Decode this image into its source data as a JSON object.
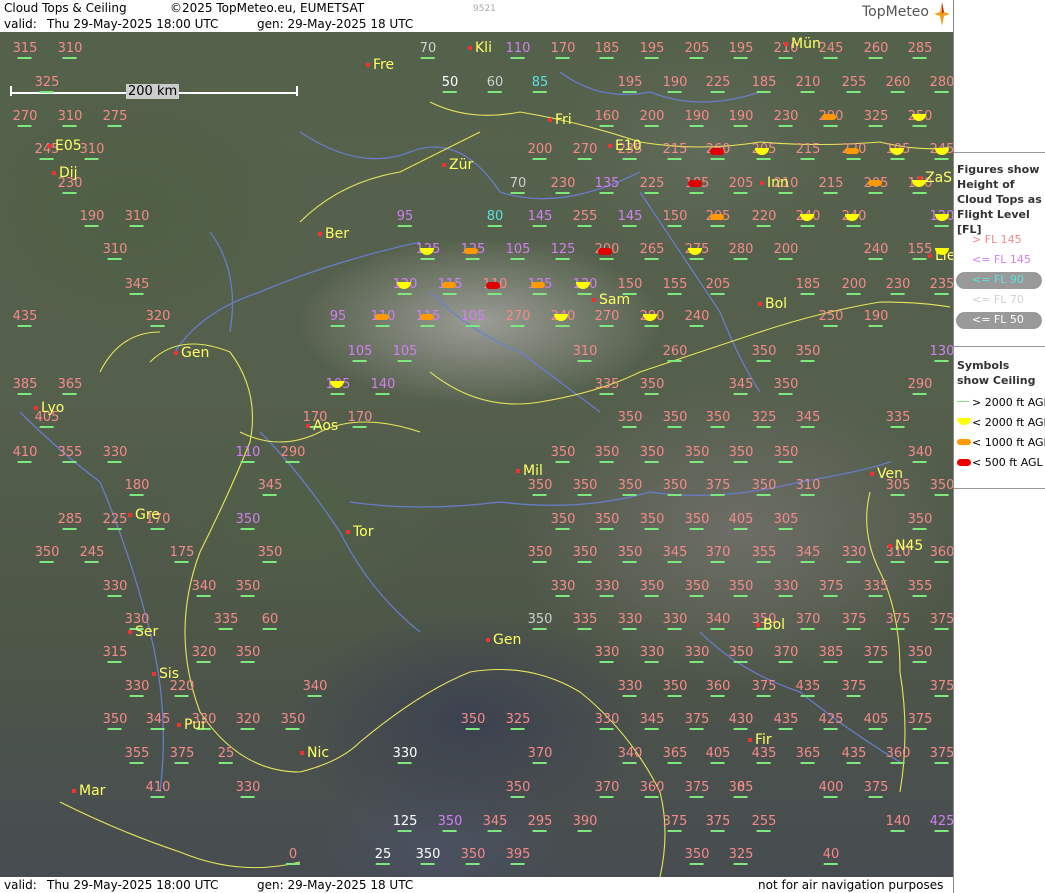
{
  "header": {
    "title": "Cloud Tops & Ceiling",
    "copyright": "©2025 TopMeteo.eu, EUMETSAT",
    "code": "9521",
    "valid_label": "valid:",
    "valid_value": "Thu  29-May-2025  18:00 UTC",
    "gen": "gen: 29-May-2025 18 UTC",
    "logo": "TopMeteo"
  },
  "scale": {
    "label": "200 km"
  },
  "legend": {
    "figures_title": "Figures show Height of Cloud Tops as Flight Level  [FL]",
    "fl_gt145": "> FL 145",
    "fl_le145": "<= FL 145",
    "fl_le90": "<= FL 90",
    "fl_le70": "<= FL 70",
    "fl_le50": "<= FL 50",
    "symbols_title": "Symbols show Ceiling",
    "ceil_2000_line": "> 2000 ft AGL",
    "ceil_2000": "< 2000 ft AGL",
    "ceil_1000": "< 1000 ft AGL",
    "ceil_500": "< 500 ft AGL",
    "colors": {
      "red": "#f58a8a",
      "magenta": "#d27ff0",
      "cyan": "#5ee0e0",
      "grey": "#d0d0d0",
      "white": "#ffffff",
      "yellow": "#ffff00",
      "orange": "#ff9900",
      "darkred": "#e00000",
      "green": "#7ee87e"
    }
  },
  "footer": {
    "valid_label": "valid:",
    "valid_value": "Thu  29-May-2025  18:00 UTC",
    "gen": "gen: 29-May-2025 18 UTC",
    "note": "not for air navigation purposes"
  },
  "cities": [
    "Fre",
    "Kli",
    "Mün",
    "Fri",
    "E05",
    "Dij",
    "Zür",
    "E10",
    "Inn",
    "ZaS",
    "Ber",
    "Lie",
    "Sam",
    "Bol",
    "Gen",
    "Lyo",
    "Aos",
    "Mil",
    "Ven",
    "Gre",
    "Tor",
    "N45",
    "Ser",
    "Gen",
    "Bol",
    "Sis",
    "Pui",
    "Nic",
    "Fir",
    "Mar"
  ],
  "values": [
    "315",
    "310",
    "70",
    "110",
    "170",
    "185",
    "195",
    "205",
    "195",
    "210",
    "245",
    "260",
    "285",
    "325",
    "50",
    "60",
    "85",
    "195",
    "190",
    "225",
    "185",
    "210",
    "255",
    "260",
    "280",
    "270",
    "310",
    "275",
    "160",
    "200",
    "190",
    "190",
    "230",
    "290",
    "325",
    "250",
    "245",
    "310",
    "200",
    "270",
    "235",
    "215",
    "260",
    "205",
    "215",
    "220",
    "195",
    "245",
    "230",
    "70",
    "230",
    "135",
    "225",
    "185",
    "205",
    "210",
    "215",
    "205",
    "170",
    "190",
    "310",
    "95",
    "80",
    "145",
    "255",
    "145",
    "150",
    "205",
    "220",
    "240",
    "240",
    "120",
    "310",
    "125",
    "125",
    "105",
    "125",
    "200",
    "265",
    "275",
    "280",
    "200",
    "240",
    "155",
    "345",
    "120",
    "115",
    "110",
    "125",
    "130",
    "150",
    "155",
    "205",
    "185",
    "200",
    "230",
    "235",
    "435",
    "320",
    "95",
    "110",
    "115",
    "105",
    "270",
    "240",
    "270",
    "290",
    "240",
    "250",
    "190",
    "105",
    "105",
    "310",
    "260",
    "350",
    "350",
    "130",
    "385",
    "365",
    "105",
    "140",
    "335",
    "350",
    "345",
    "350",
    "290",
    "405",
    "170",
    "170",
    "410",
    "355",
    "330",
    "110",
    "290",
    "350",
    "350",
    "350",
    "350",
    "350",
    "350",
    "340",
    "350",
    "350",
    "350",
    "325",
    "345",
    "335",
    "180",
    "345",
    "350",
    "350",
    "350",
    "350",
    "375",
    "350",
    "310",
    "305",
    "350",
    "285",
    "225",
    "170",
    "350",
    "350",
    "350",
    "350",
    "350",
    "405",
    "305",
    "350",
    "350",
    "245",
    "175",
    "350",
    "350",
    "350",
    "350",
    "345",
    "370",
    "355",
    "345",
    "330",
    "310",
    "360",
    "330",
    "340",
    "350",
    "330",
    "330",
    "350",
    "350",
    "350",
    "330",
    "375",
    "335",
    "355",
    "330",
    "335",
    "60",
    "350",
    "335",
    "330",
    "330",
    "340",
    "350",
    "370",
    "375",
    "375",
    "375",
    "315",
    "320",
    "350",
    "330",
    "330",
    "330",
    "350",
    "370",
    "385",
    "375",
    "350",
    "330",
    "220",
    "340",
    "330",
    "350",
    "360",
    "375",
    "435",
    "375",
    "375",
    "350",
    "345",
    "330",
    "320",
    "350",
    "350",
    "325",
    "330",
    "345",
    "375",
    "430",
    "435",
    "425",
    "405",
    "375",
    "355",
    "375",
    "25",
    "330",
    "370",
    "340",
    "365",
    "405",
    "435",
    "365",
    "435",
    "360",
    "375",
    "410",
    "330",
    "350",
    "370",
    "360",
    "375",
    "385",
    "400",
    "375",
    "0",
    "125",
    "350",
    "345",
    "295",
    "390",
    "375",
    "375",
    "255",
    "140",
    "425",
    "0",
    "25",
    "350",
    "350",
    "395",
    "350",
    "325",
    "40"
  ]
}
